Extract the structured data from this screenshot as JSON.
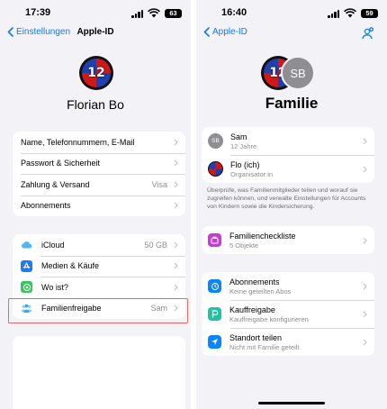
{
  "left": {
    "status": {
      "time": "17:39",
      "battery": "63"
    },
    "nav": {
      "back_label": "Einstellungen",
      "title": "Apple-ID"
    },
    "profile": {
      "name": "Florian Bo",
      "logo_text": "12"
    },
    "account_rows": [
      {
        "label": "Name, Telefonnummern, E-Mail",
        "value": ""
      },
      {
        "label": "Passwort & Sicherheit",
        "value": ""
      },
      {
        "label": "Zahlung & Versand",
        "value": "Visa"
      },
      {
        "label": "Abonnements",
        "value": ""
      }
    ],
    "service_rows": [
      {
        "label": "iCloud",
        "value": "50 GB",
        "icon": "cloud-icon",
        "color": "#5ac8fa"
      },
      {
        "label": "Medien & Käufe",
        "value": "",
        "icon": "app-store-icon",
        "color": "#1e7cf2"
      },
      {
        "label": "Wo ist?",
        "value": "",
        "icon": "find-my-icon",
        "color": "#34c759"
      },
      {
        "label": "Familienfreigabe",
        "value": "Sam",
        "icon": "family-sharing-icon",
        "color": "#5ac8fa"
      }
    ]
  },
  "right": {
    "status": {
      "time": "16:40",
      "battery": "59"
    },
    "nav": {
      "back_label": "Apple-ID"
    },
    "header": {
      "title": "Familie",
      "member_initials": "SB",
      "logo_text": "12"
    },
    "members": [
      {
        "name": "Sam",
        "subtitle": "12 Jahre",
        "initials": "SB"
      },
      {
        "name": "Flo (ich)",
        "subtitle": "Organisator:in",
        "initials": ""
      }
    ],
    "footnote": "Überprüfe, was Familienmitglieder teilen und worauf sie zugreifen können, und verwalte Einstellungen für Accounts von Kindern sowie die Kindersicherung.",
    "checklist": {
      "title": "Familiencheckliste",
      "subtitle": "5 Objekte",
      "color": "#c83cd6"
    },
    "features": [
      {
        "title": "Abonnements",
        "subtitle": "Keine geteilten Abos",
        "icon": "subscriptions-icon",
        "color": "#0a84ff"
      },
      {
        "title": "Kauffreigabe",
        "subtitle": "Kauffreigabe konfigurieren",
        "icon": "purchase-sharing-icon",
        "color": "#20c3a0"
      },
      {
        "title": "Standort teilen",
        "subtitle": "Nicht mit Familie geteilt",
        "icon": "location-icon",
        "color": "#0a84ff"
      }
    ]
  }
}
